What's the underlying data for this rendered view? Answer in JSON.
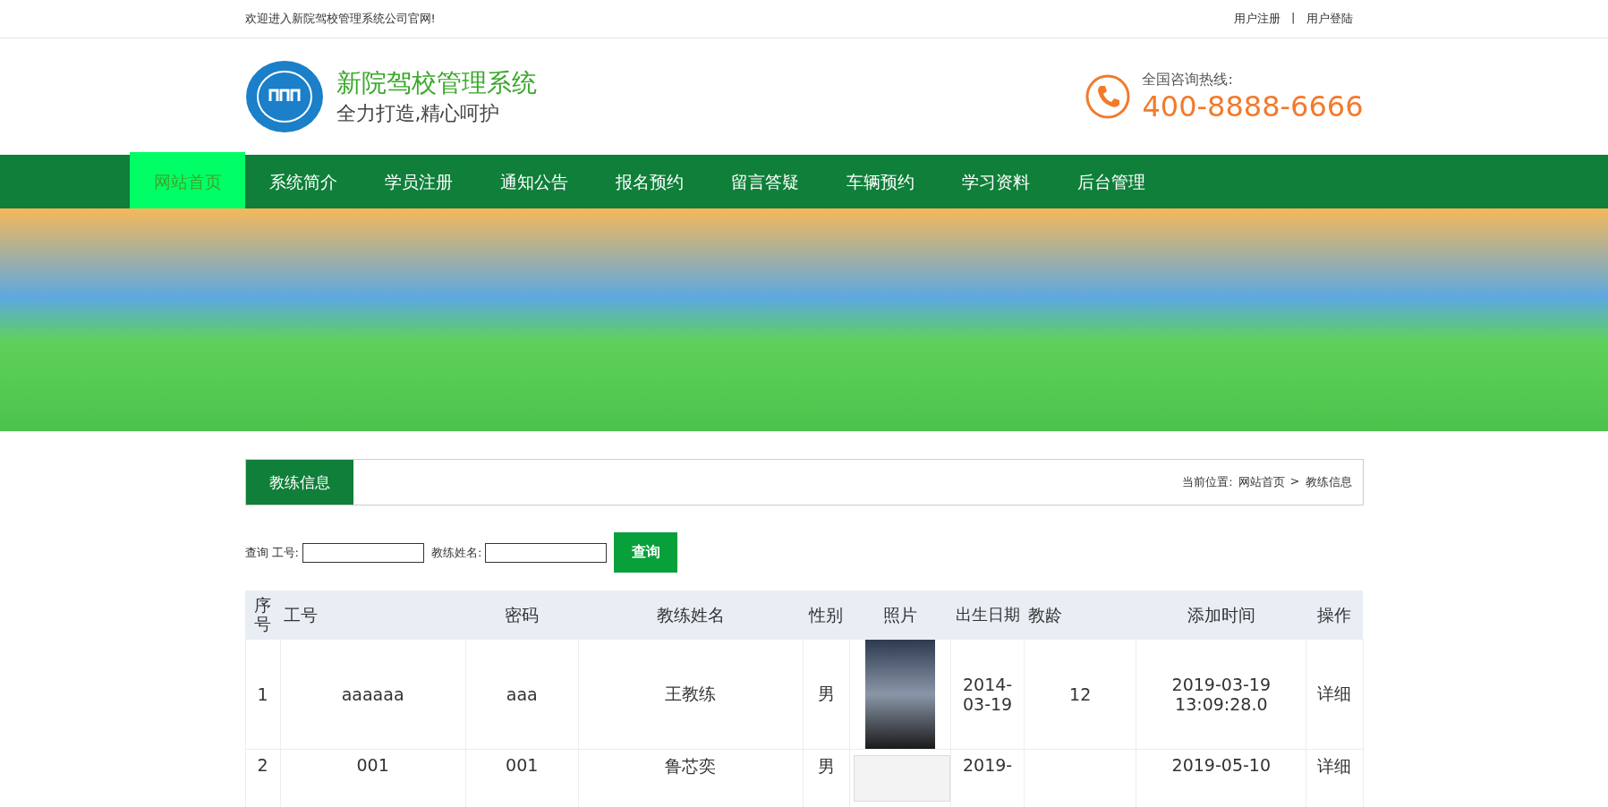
{
  "top_bar": {
    "welcome": "欢迎进入新院驾校管理系统公司官网!",
    "links": [
      "用户注册",
      "用户登陆"
    ],
    "separator": "|"
  },
  "header": {
    "title": "新院驾校管理系统",
    "slogan": "全力打造,精心呵护",
    "hotline_label": "全国咨询热线:",
    "hotline": "400-8888-6666"
  },
  "nav": [
    {
      "label": "网站首页",
      "selected": true
    },
    {
      "label": "系统简介",
      "selected": false
    },
    {
      "label": "学员注册",
      "selected": false
    },
    {
      "label": "通知公告",
      "selected": false
    },
    {
      "label": "报名预约",
      "selected": false
    },
    {
      "label": "留言答疑",
      "selected": false
    },
    {
      "label": "车辆预约",
      "selected": false
    },
    {
      "label": "学习资料",
      "selected": false
    },
    {
      "label": "后台管理",
      "selected": false
    }
  ],
  "section": {
    "title": "教练信息",
    "breadcrumb_label": "当前位置:",
    "breadcrumb": [
      "网站首页",
      "教练信息"
    ],
    "breadcrumb_separator": ">"
  },
  "search": {
    "label": "查询",
    "fields": [
      {
        "label": "工号:"
      },
      {
        "label": "教练姓名:"
      }
    ],
    "button": "查询"
  },
  "table": {
    "columns": [
      "序号",
      "工号",
      "密码",
      "教练姓名",
      "性别",
      "照片",
      "出生日期",
      "教龄",
      "添加时间",
      "操作"
    ],
    "rows": [
      {
        "no": "1",
        "id": "aaaaaa",
        "password": "aaa",
        "name": "王教练",
        "gender": "男",
        "has_photo": true,
        "birth": "2014-03-19",
        "age": "12",
        "added": "2019-03-19 13:09:28.0",
        "action": "详细"
      },
      {
        "no": "2",
        "id": "001",
        "password": "001",
        "name": "鲁芯奕",
        "gender": "男",
        "has_photo": false,
        "birth": "2019-",
        "added": "2019-05-10",
        "action": "详细"
      }
    ]
  }
}
